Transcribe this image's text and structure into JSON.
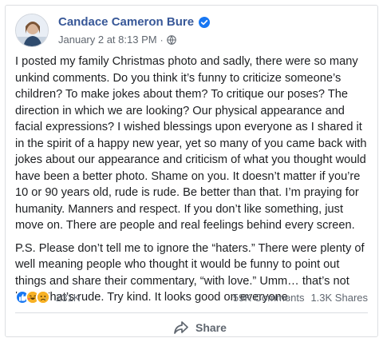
{
  "post": {
    "author": "Candace Cameron Bure",
    "timestamp": "January 2 at 8:13 PM",
    "separator": "·",
    "audience_icon": "globe-icon",
    "verified_icon": "verified-badge-icon",
    "paragraphs": [
      "I posted my family Christmas photo and sadly, there were so many unkind comments. Do you think it’s funny to criticize someone’s children? To make jokes about them? To critique our poses? The direction in which we are looking? Our physical appearance and facial expressions? I wished blessings upon everyone as I shared it in the spirit of a happy new year, yet so many of you came back with jokes about our appearance and criticism of what you thought would have been a better photo. Shame on you. It doesn’t matter if you’re 10 or 90 years old, rude is rude. Be better than that. I’m praying for humanity. Manners and respect. If you don’t like something, just move on. There are people and real feelings behind every screen.",
      "P.S. Please don’t tell me to ignore the “haters.” There were plenty of well meaning people who thought it would be funny to point out things and share their commentary, “with love.” Umm… that’s not love. That’s rude. Try kind. It looks good on everyone."
    ]
  },
  "stats": {
    "reactions_count": "231K",
    "comments": "59K Comments",
    "shares": "1.3K Shares",
    "reaction_icons": [
      "like-icon",
      "haha-icon",
      "sad-icon"
    ]
  },
  "actions": {
    "share_label": "Share"
  },
  "colors": {
    "author_link": "#385898",
    "meta_text": "#606770",
    "like_blue": "#1877f2",
    "emoji_yellow": "#f7b125"
  }
}
